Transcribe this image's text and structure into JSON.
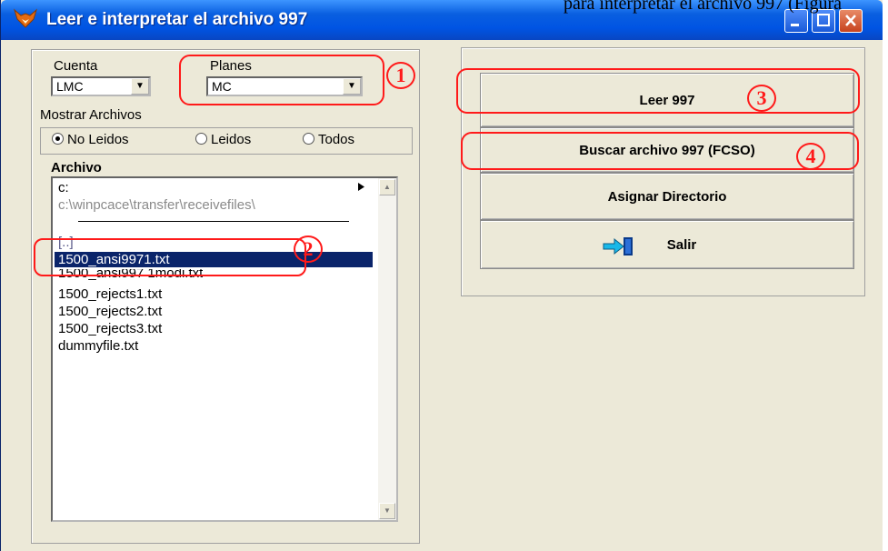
{
  "top_text": "para interpretar el archivo 997 (Figura",
  "window": {
    "title": "Leer e interpretar el archivo 997",
    "icon": "fox-icon",
    "accent_color": "#0054e3"
  },
  "cuenta": {
    "label": "Cuenta",
    "value": "LMC"
  },
  "planes": {
    "label": "Planes",
    "value": "MC"
  },
  "mostrar": {
    "label": "Mostrar Archivos",
    "options": [
      "No Leidos",
      "Leidos",
      "Todos"
    ],
    "selected": "No Leidos"
  },
  "archivo": {
    "label": "Archivo",
    "drive": "c:",
    "path": "c:\\winpcace\\transfer\\receivefiles\\",
    "up": "[..]",
    "files": [
      "1500_ansi9971.txt",
      "1500_ansi997 1modi.txt",
      "1500_rejects1.txt",
      "1500_rejects2.txt",
      "1500_rejects3.txt",
      "dummyfile.txt"
    ],
    "selected": "1500_ansi9971.txt"
  },
  "buttons": {
    "leer": "Leer 997",
    "buscar": "Buscar archivo 997 (FCSO)",
    "asignar": "Asignar Directorio",
    "salir": "Salir"
  },
  "callouts": [
    "1",
    "2",
    "3",
    "4"
  ],
  "annotation_color": "#ff1a1a"
}
